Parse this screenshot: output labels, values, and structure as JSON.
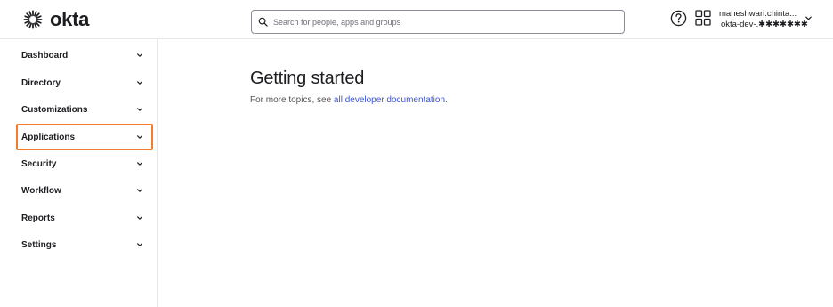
{
  "brand": {
    "name": "okta"
  },
  "search": {
    "placeholder": "Search for people, apps and groups",
    "value": ""
  },
  "header": {
    "help_icon": "question-circle-icon",
    "apps_icon": "grid-icon",
    "user": {
      "name": "maheshwari.chinta...",
      "org": "okta-dev-.✱✱✱✱✱✱✱"
    }
  },
  "sidebar": {
    "items": [
      {
        "label": "Dashboard"
      },
      {
        "label": "Directory"
      },
      {
        "label": "Customizations"
      },
      {
        "label": "Applications",
        "highlighted": true
      },
      {
        "label": "Security"
      },
      {
        "label": "Workflow"
      },
      {
        "label": "Reports"
      },
      {
        "label": "Settings"
      }
    ]
  },
  "main": {
    "title": "Getting started",
    "subtitle_prefix": "For more topics, see ",
    "subtitle_link": "all developer documentation",
    "subtitle_suffix": "."
  },
  "colors": {
    "highlight": "#f47c2e",
    "link": "#3d55d0"
  }
}
